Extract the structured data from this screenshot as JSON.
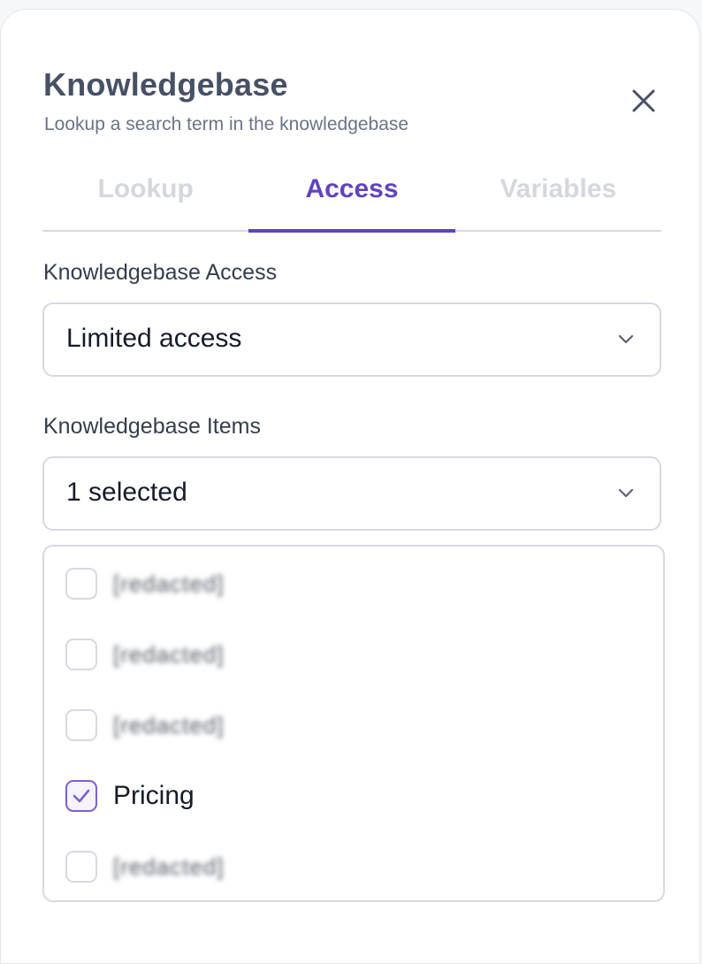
{
  "dialog": {
    "title": "Knowledgebase",
    "subtitle": "Lookup a search term in the knowledgebase",
    "close_icon": "close-icon"
  },
  "tabs": [
    {
      "label": "Lookup",
      "active": false
    },
    {
      "label": "Access",
      "active": true
    },
    {
      "label": "Variables",
      "active": false
    }
  ],
  "access_field": {
    "label": "Knowledgebase Access",
    "value": "Limited access",
    "icon": "chevron-down-icon"
  },
  "items_field": {
    "label": "Knowledgebase Items",
    "value": "1 selected",
    "icon": "chevron-down-icon",
    "options": [
      {
        "label": "[redacted]",
        "checked": false,
        "redacted": true
      },
      {
        "label": "[redacted]",
        "checked": false,
        "redacted": true
      },
      {
        "label": "[redacted]",
        "checked": false,
        "redacted": true
      },
      {
        "label": "Pricing",
        "checked": true,
        "redacted": false
      },
      {
        "label": "[redacted]",
        "checked": false,
        "redacted": true
      }
    ]
  },
  "colors": {
    "accent": "#6142c0",
    "title": "#475066",
    "border": "#d6d9df",
    "inactive_tab": "#d4d7dd"
  }
}
